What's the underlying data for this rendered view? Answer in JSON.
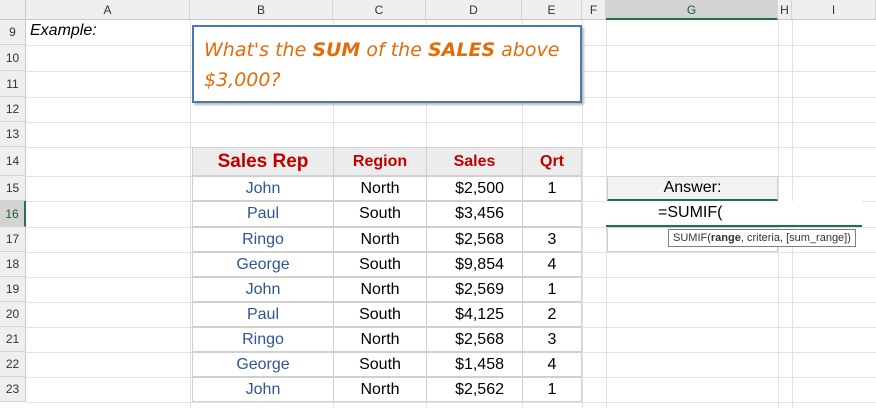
{
  "columns": [
    "A",
    "B",
    "C",
    "D",
    "E",
    "F",
    "G",
    "H",
    "I"
  ],
  "selected_column": "G",
  "rows": [
    "9",
    "10",
    "11",
    "12",
    "13",
    "14",
    "15",
    "16",
    "17",
    "18",
    "19",
    "20",
    "21",
    "22",
    "23"
  ],
  "selected_row": "16",
  "example_label": "Example:",
  "callout": {
    "pre1": "What's the ",
    "bold1": "SUM",
    "mid": " of the ",
    "bold2": "SALES",
    "post1": " above",
    "line2": "$3,000?"
  },
  "table": {
    "headers": [
      "Sales Rep",
      "Region",
      "Sales",
      "Qrt"
    ],
    "rows": [
      [
        "John",
        "North",
        "$2,500",
        "1"
      ],
      [
        "Paul",
        "South",
        "$3,456",
        ""
      ],
      [
        "Ringo",
        "North",
        "$2,568",
        "3"
      ],
      [
        "George",
        "South",
        "$9,854",
        "4"
      ],
      [
        "John",
        "North",
        "$2,569",
        "1"
      ],
      [
        "Paul",
        "South",
        "$4,125",
        "2"
      ],
      [
        "Ringo",
        "North",
        "$2,568",
        "3"
      ],
      [
        "George",
        "South",
        "$1,458",
        "4"
      ],
      [
        "John",
        "North",
        "$2,562",
        "1"
      ]
    ]
  },
  "answer_label": "Answer:",
  "formula_entry": "=SUMIF(",
  "tooltip": {
    "fn": "SUMIF(",
    "arg_bold": "range",
    "rest": ", criteria, [sum_range])"
  },
  "colors": {
    "header_red": "#c00000",
    "rep_blue": "#2f5597",
    "callout_orange": "#e36c09",
    "callout_border": "#4a78b0",
    "excel_green": "#217346"
  }
}
